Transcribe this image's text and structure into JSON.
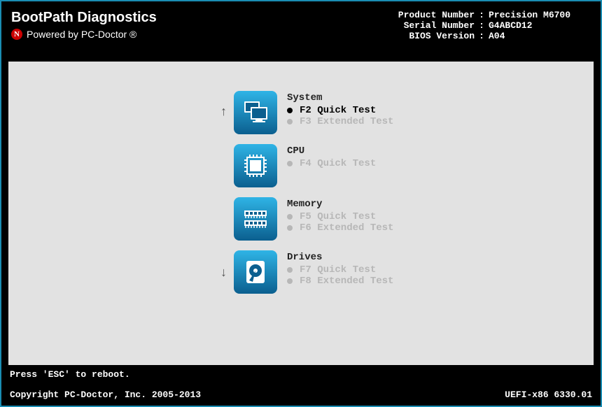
{
  "header": {
    "title": "BootPath Diagnostics",
    "subtitle": "Powered by PC-Doctor ®",
    "info": {
      "product_label": "Product Number",
      "product_value": "Precision M6700",
      "serial_label": "Serial Number",
      "serial_value": "G4ABCD12",
      "bios_label": "BIOS Version",
      "bios_value": "A04"
    }
  },
  "menu": {
    "categories": [
      {
        "name": "System",
        "options": [
          {
            "label": "F2  Quick Test",
            "selected": true
          },
          {
            "label": "F3  Extended Test",
            "selected": false
          }
        ]
      },
      {
        "name": "CPU",
        "options": [
          {
            "label": "F4  Quick Test",
            "selected": false
          }
        ]
      },
      {
        "name": "Memory",
        "options": [
          {
            "label": "F5  Quick Test",
            "selected": false
          },
          {
            "label": "F6  Extended Test",
            "selected": false
          }
        ]
      },
      {
        "name": "Drives",
        "options": [
          {
            "label": "F7  Quick Test",
            "selected": false
          },
          {
            "label": "F8  Extended Test",
            "selected": false
          }
        ]
      }
    ]
  },
  "footer": {
    "hint": "Press 'ESC' to reboot.",
    "copyright": "Copyright PC-Doctor, Inc. 2005-2013",
    "platform": "UEFI-x86 6330.01"
  }
}
